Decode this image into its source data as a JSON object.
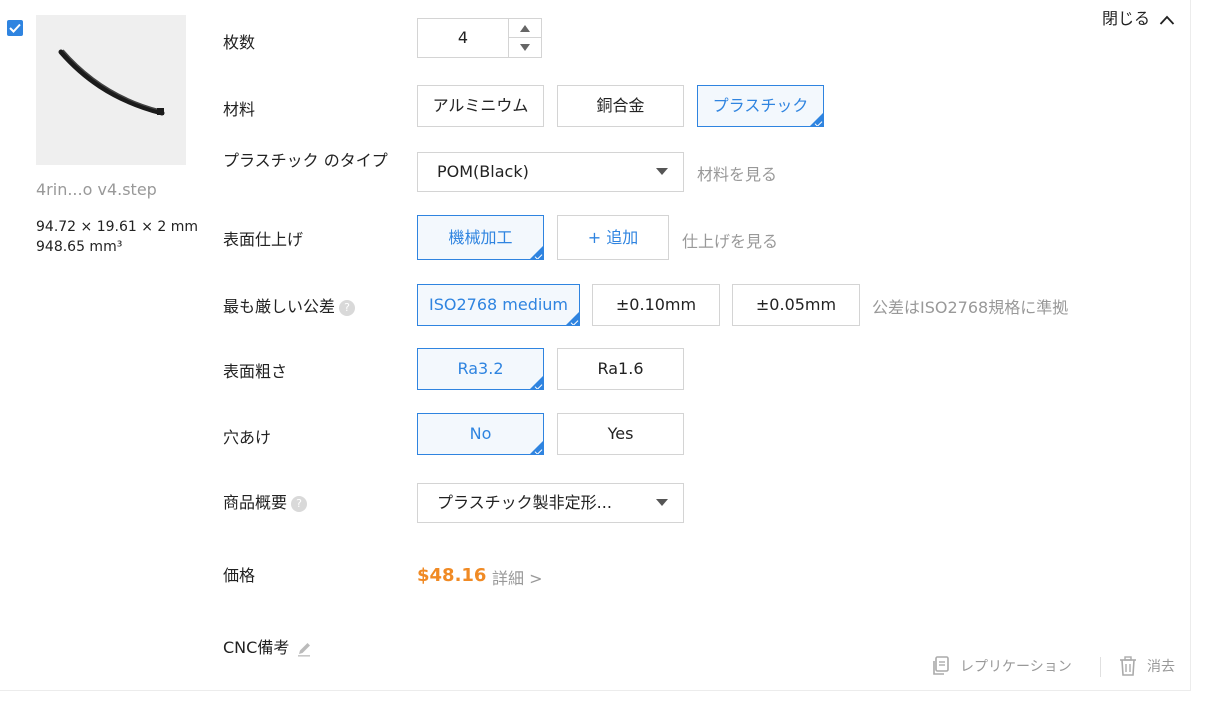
{
  "part": {
    "checked": true,
    "filename": "4rin...o v4.step",
    "dimensions": "94.72 × 19.61 × 2 mm",
    "volume": "948.65 mm³"
  },
  "close_label": "閉じる",
  "quantity": {
    "label": "枚数",
    "value": "4"
  },
  "material": {
    "label": "材料",
    "options": [
      "アルミニウム",
      "銅合金",
      "プラスチック"
    ],
    "selected": "プラスチック"
  },
  "plastic_type": {
    "label": "プラスチック のタイプ",
    "value": "POM(Black)",
    "hint": "材料を見る"
  },
  "surface_finish": {
    "label": "表面仕上げ",
    "options": [
      "機械加工"
    ],
    "selected": "機械加工",
    "add_label": "+ 追加",
    "hint": "仕上げを見る"
  },
  "tolerance": {
    "label": "最も厳しい公差",
    "options": [
      "ISO2768 medium",
      "±0.10mm",
      "±0.05mm"
    ],
    "selected": "ISO2768 medium",
    "hint": "公差はISO2768規格に準拠"
  },
  "roughness": {
    "label": "表面粗さ",
    "options": [
      "Ra3.2",
      "Ra1.6"
    ],
    "selected": "Ra3.2"
  },
  "drilling": {
    "label": "穴あけ",
    "options": [
      "No",
      "Yes"
    ],
    "selected": "No"
  },
  "product_summary": {
    "label": "商品概要",
    "value": "プラスチック製非定形..."
  },
  "price": {
    "label": "価格",
    "value": "$48.16",
    "detail": "詳細 >"
  },
  "cnc_note": {
    "label": "CNC備考"
  },
  "actions": {
    "replicate": "レプリケーション",
    "delete": "消去"
  },
  "colors": {
    "accent": "#2f84e0",
    "price": "#f08a24",
    "muted": "#999999"
  }
}
